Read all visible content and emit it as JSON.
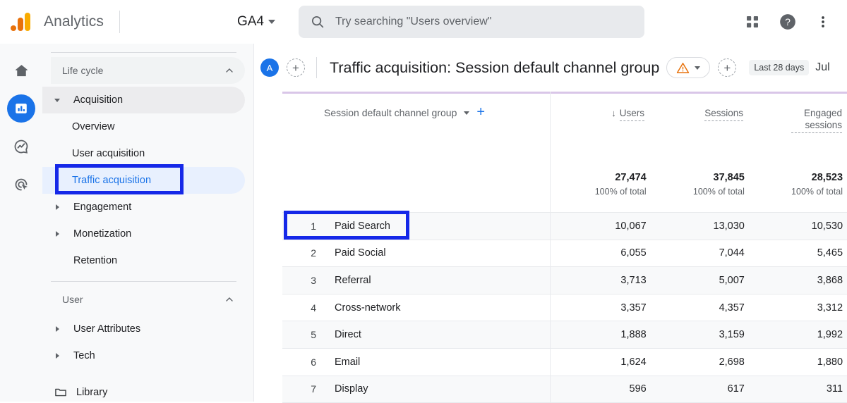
{
  "topbar": {
    "brand": "Analytics",
    "logo_icon": "analytics-logo",
    "property_label": "GA4",
    "search": {
      "placeholder": "Try searching \"Users overview\"",
      "icon": "search-icon"
    },
    "actions": [
      {
        "icon": "apps-grid-icon",
        "name": "apps-grid-button"
      },
      {
        "icon": "help-circle-icon",
        "name": "help-button"
      },
      {
        "icon": "more-vert-icon",
        "name": "more-options-button"
      }
    ]
  },
  "rail": {
    "items": [
      {
        "icon": "home-icon",
        "name": "rail-item-home",
        "active": false
      },
      {
        "icon": "reports-bar-chart-icon",
        "name": "rail-item-reports",
        "active": true
      },
      {
        "icon": "explore-trending-icon",
        "name": "rail-item-explore",
        "active": false
      },
      {
        "icon": "advertising-target-icon",
        "name": "rail-item-advertising",
        "active": false
      }
    ],
    "active_color": "#1a73e8"
  },
  "nav": {
    "sections": [
      {
        "label": "Life cycle",
        "collapse_icon": "chevron-up-icon",
        "items": [
          {
            "label": "Acquisition",
            "type": "group",
            "expanded": true,
            "arrow": "caret-down-icon"
          },
          {
            "label": "Overview",
            "type": "child",
            "selected": false
          },
          {
            "label": "User acquisition",
            "type": "child",
            "selected": false
          },
          {
            "label": "Traffic acquisition",
            "type": "child",
            "selected": true
          },
          {
            "label": "Engagement",
            "type": "group",
            "expanded": false,
            "arrow": "caret-right-icon"
          },
          {
            "label": "Monetization",
            "type": "group",
            "expanded": false,
            "arrow": "caret-right-icon"
          },
          {
            "label": "Retention",
            "type": "plain",
            "selected": false
          }
        ]
      },
      {
        "label": "User",
        "collapse_icon": "chevron-up-icon",
        "items": [
          {
            "label": "User Attributes",
            "type": "group",
            "expanded": false,
            "arrow": "caret-right-icon"
          },
          {
            "label": "Tech",
            "type": "group",
            "expanded": false,
            "arrow": "caret-right-icon"
          }
        ]
      }
    ],
    "library": {
      "label": "Library",
      "icon": "folder-icon"
    }
  },
  "header": {
    "avatar_initial": "A",
    "add_comparison_icon": "add-circle-dashed-icon",
    "title": "Traffic acquisition: Session default channel group",
    "warning_icon": "warning-triangle-icon",
    "warning_color": "#e8710a",
    "warning_caret_icon": "caret-down-icon",
    "add_icon": "add-circle-dashed-icon",
    "date_range": "Last 28 days",
    "date_range_more": "Jul"
  },
  "table": {
    "dimension": {
      "label": "Session default channel group",
      "caret_icon": "caret-down-icon",
      "add_icon": "plus-icon"
    },
    "metrics": [
      {
        "label": "Users",
        "sorted": true,
        "sort_icon": "arrow-down-icon"
      },
      {
        "label": "Sessions",
        "sorted": false
      },
      {
        "label": "Engaged sessions",
        "sorted": false
      }
    ],
    "totals": {
      "values": [
        "27,474",
        "37,845",
        "28,523"
      ],
      "subtitles": [
        "100% of total",
        "100% of total",
        "100% of total"
      ]
    },
    "rows": [
      {
        "rank": "1",
        "name": "Paid Search",
        "users": "10,067",
        "sessions": "13,030",
        "engaged": "10,530"
      },
      {
        "rank": "2",
        "name": "Paid Social",
        "users": "6,055",
        "sessions": "7,044",
        "engaged": "5,465"
      },
      {
        "rank": "3",
        "name": "Referral",
        "users": "3,713",
        "sessions": "5,007",
        "engaged": "3,868"
      },
      {
        "rank": "4",
        "name": "Cross-network",
        "users": "3,357",
        "sessions": "4,357",
        "engaged": "3,312"
      },
      {
        "rank": "5",
        "name": "Direct",
        "users": "1,888",
        "sessions": "3,159",
        "engaged": "1,992"
      },
      {
        "rank": "6",
        "name": "Email",
        "users": "1,624",
        "sessions": "2,698",
        "engaged": "1,880"
      },
      {
        "rank": "7",
        "name": "Display",
        "users": "596",
        "sessions": "617",
        "engaged": "311"
      }
    ]
  },
  "annotations": {
    "color": "#1528e8",
    "targets": [
      "nav-item-traffic-acquisition",
      "table-row-paid-search"
    ]
  }
}
